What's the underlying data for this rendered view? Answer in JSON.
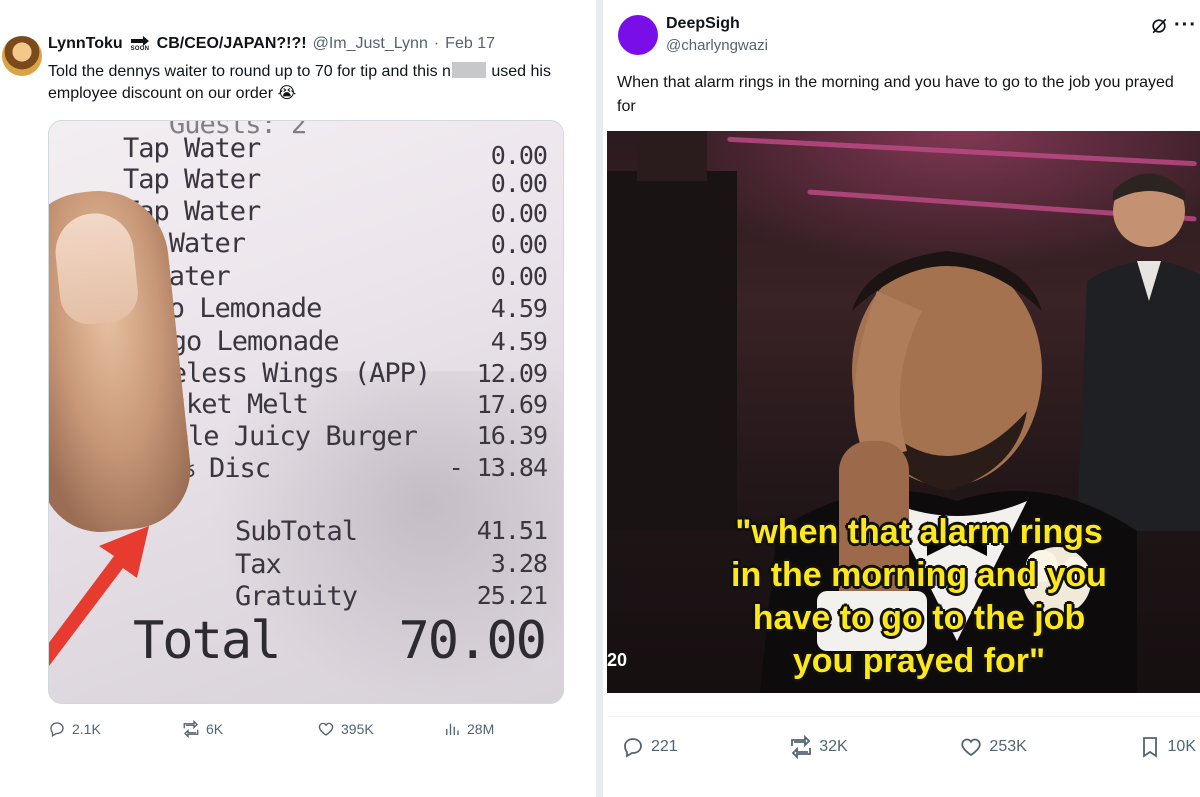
{
  "left_tweet": {
    "display_name": "LynnToku",
    "soon_badge": "SOON",
    "name_suffix": "CB/CEO/JAPAN?!?!",
    "handle": "@Im_Just_Lynn",
    "separator": "·",
    "date": "Feb 17",
    "text_part1": "Told the dennys waiter to round up to 70 for tip and this n",
    "text_part2": " used his employee discount on our order 😭",
    "receipt": {
      "header_fragment": "Guests:  2",
      "items": [
        {
          "label": "Tap Water",
          "value": "0.00"
        },
        {
          "label": "Tap Water",
          "value": "0.00"
        },
        {
          "label": "Tap Water",
          "value": "0.00"
        },
        {
          "label": "ap Water",
          "value": "0.00"
        },
        {
          "label": "p Water",
          "value": "0.00"
        },
        {
          "label": "ango Lemonade",
          "value": "4.59"
        },
        {
          "label": "Mango Lemonade",
          "value": "4.59"
        },
        {
          "label": "Boneless Wings (APP)",
          "value": "12.09"
        },
        {
          "label": "Brisket Melt",
          "value": "17.69"
        },
        {
          "label": "Triple Juicy Burger",
          "value": "16.39"
        },
        {
          "label": "Emp 25% Disc",
          "value": "- 13.84"
        }
      ],
      "summary": [
        {
          "label": "SubTotal",
          "value": "41.51"
        },
        {
          "label": "Tax",
          "value": "3.28"
        },
        {
          "label": "Gratuity",
          "value": "25.21"
        }
      ],
      "total_label": "Total",
      "total_value": "70.00"
    },
    "actions": {
      "replies": "2.1K",
      "reposts": "6K",
      "likes": "395K",
      "views": "28M"
    }
  },
  "right_tweet": {
    "display_name": "DeepSigh",
    "handle": "@charlyngwazi",
    "text": "When that alarm rings in the morning and you have to go to the job you prayed for",
    "video": {
      "caption_line1": "\"when that alarm rings",
      "caption_line2": "in the morning and you",
      "caption_line3": "have to go to the job",
      "caption_line4": "you prayed for\"",
      "timecode": "20"
    },
    "actions": {
      "replies": "221",
      "reposts": "32K",
      "likes": "253K",
      "bookmarks": "10K"
    }
  },
  "colors": {
    "text_primary": "#0f1419",
    "text_secondary": "#536471",
    "avatar_right": "#7a0ee8",
    "caption_yellow": "#ffe81a",
    "arrow_red": "#e63b2e"
  }
}
